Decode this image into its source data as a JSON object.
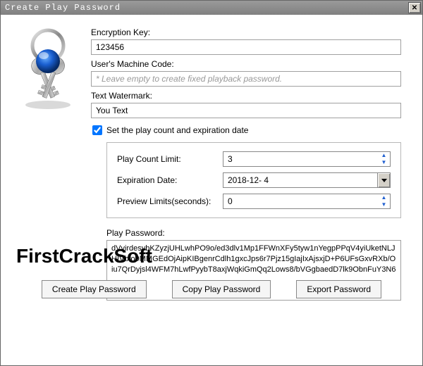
{
  "window": {
    "title": "Create Play Password",
    "close": "✕"
  },
  "labels": {
    "encryption_key": "Encryption Key:",
    "machine_code": "User's Machine Code:",
    "machine_code_placeholder": "* Leave empty to create fixed playback password.",
    "text_watermark": "Text Watermark:",
    "set_play_count": "Set the play count and expiration date",
    "play_count_limit": "Play Count Limit:",
    "expiration_date": "Expiration Date:",
    "preview_limits": "Preview Limits(seconds):",
    "play_password": "Play Password:"
  },
  "values": {
    "encryption_key": "123456",
    "machine_code": "",
    "text_watermark": "You Text",
    "set_play_count_checked": true,
    "play_count_limit": "3",
    "expiration_date": "2018-12-  4",
    "preview_limits": "0",
    "play_password": "dVvirdesybKZyzjUHLwhPO9o/ed3dlv1Mp1FFWnXFy5tyw1nYegpPPqV4yiUketNLJHIVbfo9MMGEdOjAipKIBgenrCdlh1gxcJps6r7Pjz15gIajIxAjsxjD+P6UFsGxvRXb/Oiu7QrDyjsl4WFM7hLwfPyybT8axjWqkiGmQq2Lows8/bVGgbaedD7lk9ObnFuY3N6"
  },
  "buttons": {
    "create": "Create Play Password",
    "copy": "Copy Play Password",
    "export": "Export Password"
  },
  "overlay": "FirstCrackSoft"
}
